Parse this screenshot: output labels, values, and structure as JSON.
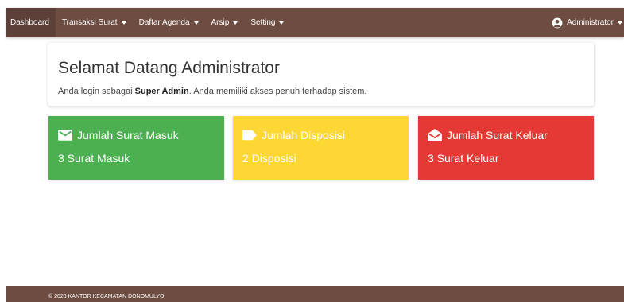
{
  "navbar": {
    "items": [
      {
        "label": "Dashboard"
      },
      {
        "label": "Transaksi Surat"
      },
      {
        "label": "Daftar Agenda"
      },
      {
        "label": "Arsip"
      },
      {
        "label": "Setting"
      }
    ],
    "user_label": "Administrator",
    "icon": "account-circle-icon",
    "color": "#6d4c41"
  },
  "welcome": {
    "title": "Selamat Datang Administrator",
    "line_prefix": "Anda login sebagai ",
    "role": "Super Admin",
    "line_suffix": ". Anda memiliki akses penuh terhadap sistem."
  },
  "cards": [
    {
      "title": "Jumlah Surat Masuk",
      "value": "3 Surat Masuk",
      "color": "#4caf50",
      "icon": "mail-icon"
    },
    {
      "title": "Jumlah Disposisi",
      "value": "2 Disposisi",
      "color": "#fdd835",
      "icon": "label-icon"
    },
    {
      "title": "Jumlah Surat Keluar",
      "value": "3 Surat Keluar",
      "color": "#e53935",
      "icon": "drafts-icon"
    }
  ],
  "footer": {
    "text": "© 2023 KANTOR KECAMATAN DONOMULYO"
  }
}
